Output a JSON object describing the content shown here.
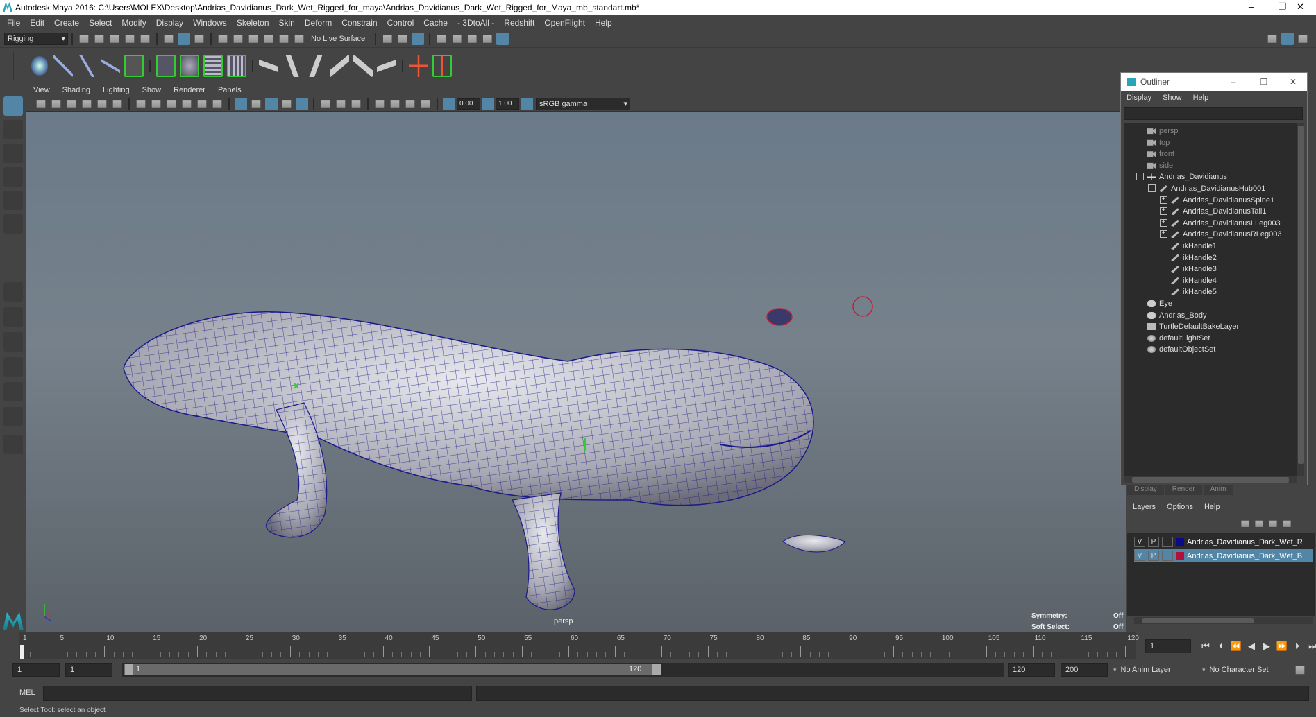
{
  "window": {
    "title": "Autodesk Maya 2016: C:\\Users\\MOLEX\\Desktop\\Andrias_Davidianus_Dark_Wet_Rigged_for_maya\\Andrias_Davidianus_Dark_Wet_Rigged_for_Maya_mb_standart.mb*",
    "minimize": "–",
    "restore": "❐",
    "close": "✕"
  },
  "menubar": [
    "File",
    "Edit",
    "Create",
    "Select",
    "Modify",
    "Display",
    "Windows",
    "Skeleton",
    "Skin",
    "Deform",
    "Constrain",
    "Control",
    "Cache",
    "- 3DtoAll -",
    "Redshift",
    "OpenFlight",
    "Help"
  ],
  "statusline": {
    "menuset": "Rigging",
    "live_surface": "No Live Surface"
  },
  "viewport": {
    "menu": [
      "View",
      "Shading",
      "Lighting",
      "Show",
      "Renderer",
      "Panels"
    ],
    "near_value": "0.00",
    "far_value": "1.00",
    "color_space": "sRGB gamma",
    "camera_label": "persp",
    "symmetry_label": "Symmetry:",
    "symmetry_value": "Off",
    "soft_select_label": "Soft Select:",
    "soft_select_value": "Off"
  },
  "outliner": {
    "title": "Outliner",
    "menu": [
      "Display",
      "Show",
      "Help"
    ],
    "nodes": [
      {
        "label": "persp",
        "depth": 0,
        "kind": "cam"
      },
      {
        "label": "top",
        "depth": 0,
        "kind": "cam"
      },
      {
        "label": "front",
        "depth": 0,
        "kind": "cam"
      },
      {
        "label": "side",
        "depth": 0,
        "kind": "cam"
      },
      {
        "label": "Andrias_Davidianus",
        "depth": 0,
        "kind": "group",
        "exp": "−"
      },
      {
        "label": "Andrias_DavidianusHub001",
        "depth": 1,
        "kind": "joint",
        "exp": "−"
      },
      {
        "label": "Andrias_DavidianusSpine1",
        "depth": 2,
        "kind": "joint",
        "exp": "+"
      },
      {
        "label": "Andrias_DavidianusTail1",
        "depth": 2,
        "kind": "joint",
        "exp": "+"
      },
      {
        "label": "Andrias_DavidianusLLeg003",
        "depth": 2,
        "kind": "joint",
        "exp": "+"
      },
      {
        "label": "Andrias_DavidianusRLeg003",
        "depth": 2,
        "kind": "joint",
        "exp": "+"
      },
      {
        "label": "ikHandle1",
        "depth": 2,
        "kind": "ik"
      },
      {
        "label": "ikHandle2",
        "depth": 2,
        "kind": "ik"
      },
      {
        "label": "ikHandle3",
        "depth": 2,
        "kind": "ik"
      },
      {
        "label": "ikHandle4",
        "depth": 2,
        "kind": "ik"
      },
      {
        "label": "ikHandle5",
        "depth": 2,
        "kind": "ik"
      },
      {
        "label": "Eye",
        "depth": 0,
        "kind": "mesh"
      },
      {
        "label": "Andrias_Body",
        "depth": 0,
        "kind": "mesh"
      },
      {
        "label": "TurtleDefaultBakeLayer",
        "depth": 0,
        "kind": "layer"
      },
      {
        "label": "defaultLightSet",
        "depth": 0,
        "kind": "set"
      },
      {
        "label": "defaultObjectSet",
        "depth": 0,
        "kind": "set"
      }
    ]
  },
  "layer_editor": {
    "tabs": [
      "Display",
      "Render",
      "Anim"
    ],
    "menu": [
      "Layers",
      "Options",
      "Help"
    ],
    "layers": [
      {
        "v": "V",
        "p": "P",
        "name": "Andrias_Davidianus_Dark_Wet_R",
        "color": "#0a0a8a",
        "selected": false
      },
      {
        "v": "V",
        "p": "P",
        "name": "Andrias_Davidianus_Dark_Wet_B",
        "color": "#b0103a",
        "selected": true
      }
    ]
  },
  "timeline": {
    "labels": [
      "1",
      "5",
      "10",
      "15",
      "20",
      "25",
      "30",
      "35",
      "40",
      "45",
      "50",
      "55",
      "60",
      "65",
      "70",
      "75",
      "80",
      "85",
      "90",
      "95",
      "100",
      "105",
      "110",
      "115",
      "120"
    ],
    "current_frame": "1"
  },
  "range": {
    "start": "1",
    "playback_start": "1",
    "slider_start": "1",
    "slider_end": "120",
    "playback_end": "120",
    "end": "200",
    "anim_layer": "No Anim Layer",
    "char_set": "No Character Set"
  },
  "command": {
    "label": "MEL",
    "help": "Select Tool: select an object"
  }
}
